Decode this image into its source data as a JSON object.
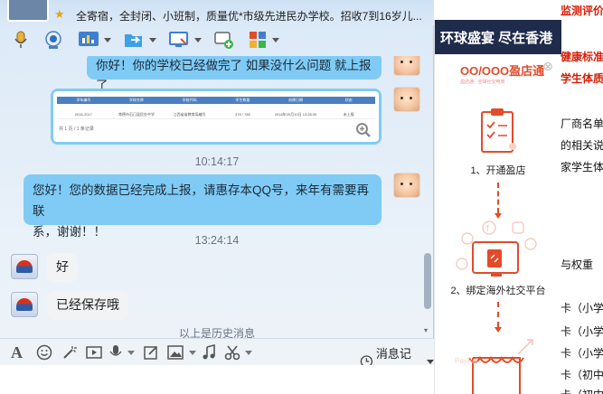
{
  "background_page": {
    "lines": [
      {
        "text": "监测评价",
        "red": true
      },
      {
        "text": "健康标准",
        "red": true
      },
      {
        "text": "学生体质健",
        "red": true
      },
      {
        "text": "厂商名单",
        "red": false
      },
      {
        "text": "的相关说明",
        "red": false
      },
      {
        "text": "家学生体",
        "red": false
      },
      {
        "text": "与权重",
        "red": false
      },
      {
        "text": "卡（小学",
        "red": false
      },
      {
        "text": "卡（小学",
        "red": false
      },
      {
        "text": "卡（小学",
        "red": false
      },
      {
        "text": "卡（初中",
        "red": false
      },
      {
        "text": "卡（初中",
        "red": false
      }
    ]
  },
  "chat": {
    "status_text": "全寄宿，全封闭、小班制，质量优*市级先进民办学校。招收7到16岁儿...",
    "messages": {
      "m1": "你好！你的学校已经做完了  如果没什么问题 就上报了",
      "screenshot_cells": {
        "head": [
          "学年编号",
          "学校名称",
          "学校代码",
          "学生数量",
          "创建日期",
          "状态"
        ],
        "row": [
          "2016-2017",
          "常德市石门县民办中学",
          "江西省省教育局编号",
          "378 / 788",
          "2016年09月10日 13:28:30",
          "未上报"
        ],
        "foot": "共 1 页 / 1 条记录"
      },
      "time1": "10:14:17",
      "m2_line1": "您好！您的数据已经完成上报，请惠存本QQ号，来年有需要再联",
      "m2_line2": "系，谢谢！！",
      "time2": "13:24:14",
      "m3": "好",
      "m4": "已经保存哦",
      "history_hint": "以上是历史消息"
    },
    "input_toolbar": {
      "record_label": "消息记录"
    }
  },
  "ad": {
    "banner": "环球盛宴 尽在香港",
    "brand": "OO/OOO盈店通",
    "brand_sub": "盈店通 · 全球社交电商",
    "step1": "1、开通盈店",
    "step2": "2、绑定海外社交平台"
  },
  "colors": {
    "bubble_out": "#7fcbf6",
    "bubble_in": "#f2f3f5",
    "ad_red": "#e24b2b",
    "banner_bg": "#1f2b4a"
  }
}
